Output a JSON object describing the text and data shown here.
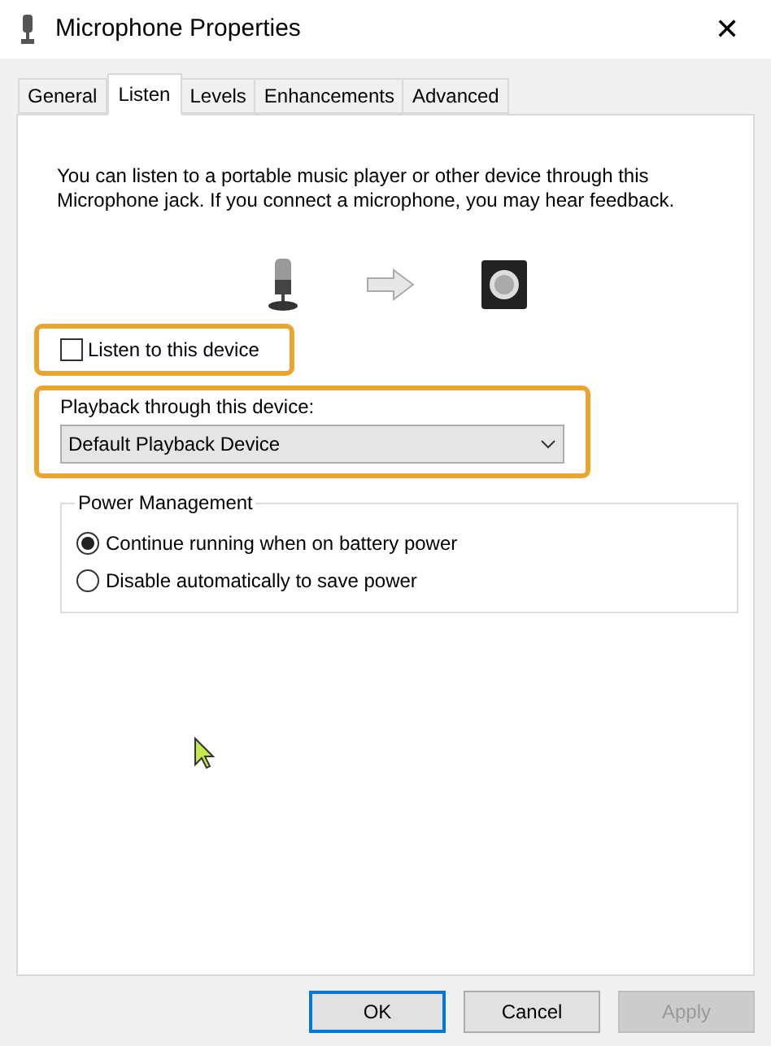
{
  "window": {
    "title": "Microphone Properties",
    "close": "✕"
  },
  "tabs": [
    {
      "label": "General",
      "selected": false
    },
    {
      "label": "Listen",
      "selected": true
    },
    {
      "label": "Levels",
      "selected": false
    },
    {
      "label": "Enhancements",
      "selected": false
    },
    {
      "label": "Advanced",
      "selected": false
    }
  ],
  "description": "You can listen to a portable music player or other device through this Microphone jack.  If you connect a microphone, you may hear feedback.",
  "listen_checkbox": {
    "label": "Listen to this device",
    "checked": false,
    "highlighted": true
  },
  "playback": {
    "label": "Playback through this device:",
    "value": "Default Playback Device",
    "highlighted": true
  },
  "power_management": {
    "title": "Power Management",
    "options": [
      {
        "label": "Continue running when on battery power",
        "selected": true
      },
      {
        "label": "Disable automatically to save power",
        "selected": false
      }
    ]
  },
  "buttons": [
    {
      "label": "OK",
      "default": true,
      "disabled": false
    },
    {
      "label": "Cancel",
      "default": false,
      "disabled": false
    },
    {
      "label": "Apply",
      "default": false,
      "disabled": true
    }
  ]
}
